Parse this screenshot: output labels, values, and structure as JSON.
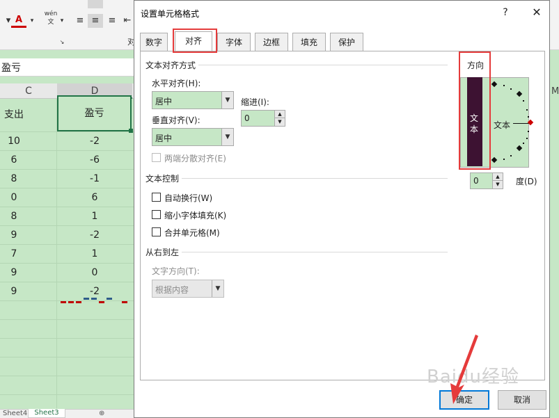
{
  "ribbon": {
    "font_color_btn": "A",
    "phonetic_btn": "wén",
    "phonetic_btn_sub": "文",
    "partial_right_label": "对"
  },
  "formula_bar": {
    "value": "盈亏"
  },
  "columns": [
    "C",
    "D"
  ],
  "partial_col_right": "M",
  "sheet": {
    "header_c": "支出",
    "header_d": "盈亏",
    "col_c": [
      "10",
      "6",
      "8",
      "0",
      "8",
      "9",
      "7",
      "9",
      "9"
    ],
    "col_d": [
      "-2",
      "-6",
      "-1",
      "6",
      "1",
      "-2",
      "1",
      "0",
      "-2"
    ]
  },
  "sheet_tabs": [
    "Sheet4",
    "Sheet3"
  ],
  "dialog": {
    "title": "设置单元格格式",
    "help": "?",
    "close": "✕",
    "tabs": [
      "数字",
      "对齐",
      "字体",
      "边框",
      "填充",
      "保护"
    ],
    "active_tab": "对齐",
    "text_alignment": {
      "group_title": "文本对齐方式",
      "horizontal_label": "水平对齐(H):",
      "horizontal_value": "居中",
      "indent_label": "缩进(I):",
      "indent_value": "0",
      "vertical_label": "垂直对齐(V):",
      "vertical_value": "居中",
      "distributed_label": "两端分散对齐(E)"
    },
    "text_control": {
      "group_title": "文本控制",
      "wrap_text": "自动换行(W)",
      "shrink_to_fit": "缩小字体填充(K)",
      "merge_cells": "合并单元格(M)"
    },
    "rtl": {
      "group_title": "从右到左",
      "direction_label": "文字方向(T):",
      "direction_value": "根据内容"
    },
    "orientation": {
      "group_title": "方向",
      "vertical_text": [
        "文",
        "本"
      ],
      "horizontal_text": "文本",
      "degrees_value": "0",
      "degrees_label": "度(D)"
    },
    "ok": "确定",
    "cancel": "取消"
  },
  "watermark": "Baidu经验",
  "colors": {
    "cell_fill": "#c6e7c6",
    "highlight": "#e53b3b",
    "selection": "#217346",
    "vertical_text_bg": "#3d1232",
    "ok_border": "#0078d7"
  }
}
